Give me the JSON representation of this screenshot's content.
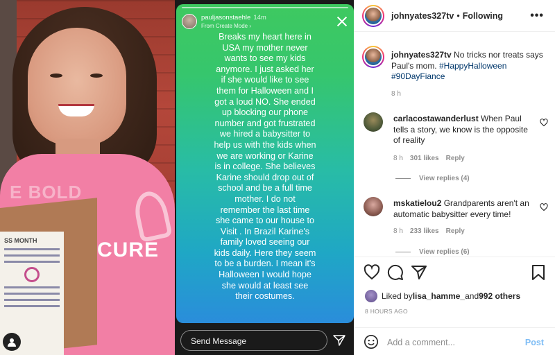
{
  "photo": {
    "shirt_text_1": "E BOLD",
    "shirt_text_2": "CURE",
    "paper_title": "SS MONTH"
  },
  "story": {
    "username": "pauljasonstaehle",
    "time": "14m",
    "subtitle": "From Create Mode ›",
    "text": "Breaks my heart here in\nUSA my mother never\nwants to see my kids\nanymore. I just asked her\nif she would like to see\nthem for Halloween and I\ngot a loud NO.  She ended\nup blocking our phone\nnumber and got frustrated\nwe hired a babysitter to\nhelp us with the kids when\nwe are working or Karine\nis in college. She believes\nKarine should drop out of\nschool and be a full time\nmother.  I do not\nremember the last time\nshe came to our house to\nVisit . In Brazil Karine's\nfamily loved seeing our\nkids daily. Here they seem\nto be a burden. I mean it's\nHalloween I would hope\nshe would at least see\ntheir costumes.",
    "message_placeholder": "Send Message"
  },
  "post": {
    "header": {
      "username": "johnyates327tv",
      "separator": "•",
      "follow_label": "Following",
      "more": "•••"
    },
    "caption": {
      "username": "johnyates327tv",
      "text": " No tricks nor treats says Paul's mom. ",
      "tag1": "#HappyHalloween",
      "tag2": "#90DayFiance",
      "time": "8 h"
    },
    "comments": [
      {
        "username": "carlacostawanderlust",
        "text": " When Paul tells a story, we know is the opposite of reality",
        "time": "8 h",
        "likes": "301 likes",
        "reply": "Reply",
        "view_replies": "View replies (4)"
      },
      {
        "username": "mskatielou2",
        "text": " Grandparents aren't an automatic babysitter every time!",
        "time": "8 h",
        "likes": "233 likes",
        "reply": "Reply",
        "view_replies": "View replies (6)"
      }
    ],
    "liked_by_prefix": "Liked by ",
    "liked_by_user": "lisa_hamme_",
    "liked_by_and": " and ",
    "liked_by_others": "992 others",
    "ago": "8 HOURS AGO",
    "comment_placeholder": "Add a comment...",
    "post_label": "Post"
  },
  "colors": {
    "link": "#00376b",
    "post_button": "#7fbdf5",
    "story_gradient_top": "#3ec960",
    "story_gradient_bottom": "#2a8ddb"
  }
}
